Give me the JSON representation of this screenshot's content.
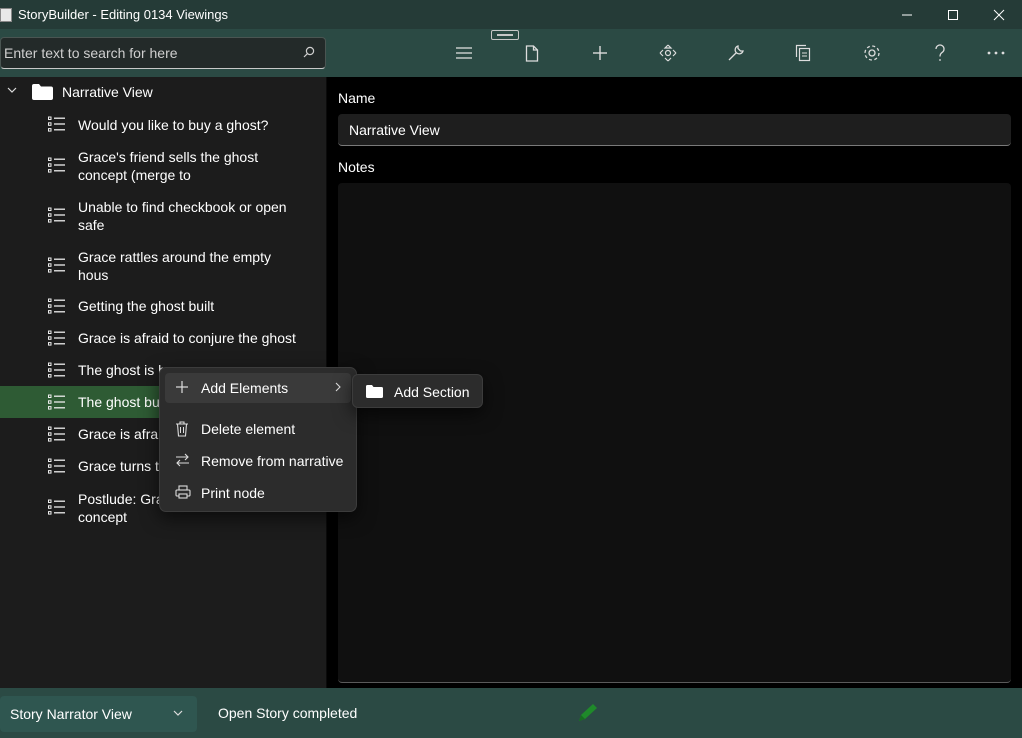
{
  "window": {
    "title": "StoryBuilder - Editing 0134 Viewings"
  },
  "search": {
    "placeholder": "Enter text to search for here"
  },
  "tree": {
    "root_label": "Narrative View",
    "items": [
      {
        "label": "Would you like to buy a ghost?"
      },
      {
        "label": "Grace's friend sells the ghost concept  (merge to"
      },
      {
        "label": "Unable to find checkbook or open safe"
      },
      {
        "label": "Grace rattles around the empty hous"
      },
      {
        "label": "Getting the ghost built"
      },
      {
        "label": "Grace is afraid to conjure the ghost"
      },
      {
        "label": "The ghost is h"
      },
      {
        "label": "The ghost bu"
      },
      {
        "label": "Grace is afrai"
      },
      {
        "label": "Grace turns t"
      },
      {
        "label": "Postlude: Gra concept"
      }
    ]
  },
  "details": {
    "name_label": "Name",
    "name_value": "Narrative View",
    "notes_label": "Notes"
  },
  "context_menu": {
    "add_elements": "Add Elements",
    "delete_element": "Delete element",
    "remove_from_narrative": "Remove from narrative",
    "print_node": "Print node"
  },
  "submenu": {
    "add_section": "Add Section"
  },
  "statusbar": {
    "view_selected": "Story Narrator View",
    "status": "Open Story completed"
  },
  "colors": {
    "titlebar": "#253b37",
    "toolbar": "#2b4a44",
    "selected_row": "#2e5b34",
    "pencil": "#1f8a2a"
  }
}
